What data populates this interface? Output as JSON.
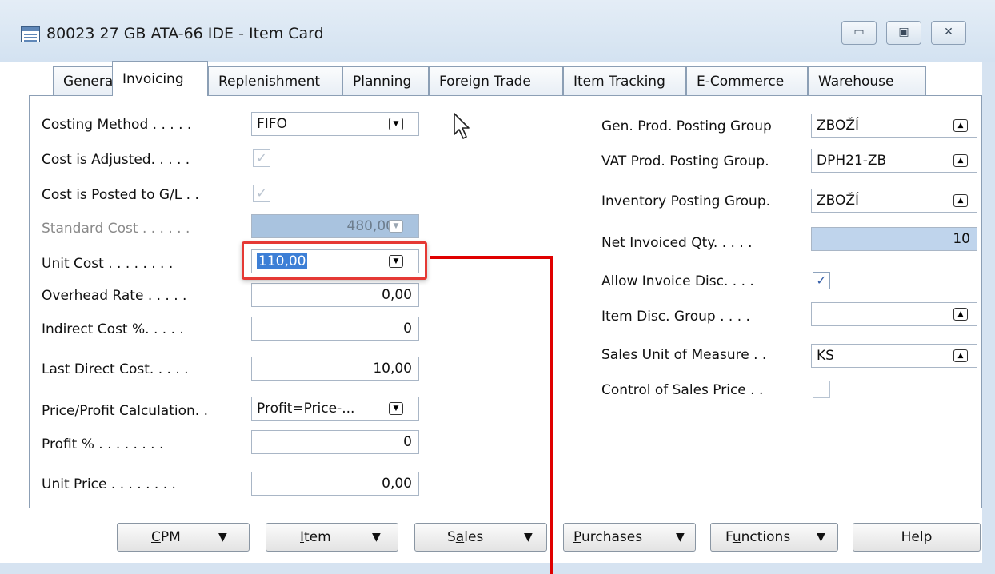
{
  "window": {
    "title": "80023 27 GB ATA-66 IDE - Item Card",
    "controls": {
      "minimize": "▭",
      "maximize": "▣",
      "close": "✕"
    }
  },
  "tabs": [
    "General",
    "Invoicing",
    "Replenishment",
    "Planning",
    "Foreign Trade",
    "Item Tracking",
    "E-Commerce",
    "Warehouse"
  ],
  "active_tab": "Invoicing",
  "left": {
    "costing_method": {
      "label": "Costing Method . . . . .",
      "value": "FIFO"
    },
    "cost_adjusted": {
      "label": "Cost is Adjusted. . . . .",
      "checked": true
    },
    "cost_posted": {
      "label": "Cost is Posted to G/L . .",
      "checked": true
    },
    "standard_cost": {
      "label": "Standard Cost . . . . . .",
      "value": "480,00"
    },
    "unit_cost": {
      "label": "Unit Cost . . . . . . . .",
      "value": "110,00"
    },
    "overhead_rate": {
      "label": "Overhead Rate . . . . .",
      "value": "0,00"
    },
    "indirect_cost": {
      "label": "Indirect Cost %. . . . .",
      "value": "0"
    },
    "last_direct_cost": {
      "label": "Last Direct Cost. . . . .",
      "value": "10,00"
    },
    "price_profit_calc": {
      "label": "Price/Profit Calculation. .",
      "value": "Profit=Price-..."
    },
    "profit_pct": {
      "label": "Profit % . . . . . . . .",
      "value": "0"
    },
    "unit_price": {
      "label": "Unit Price . . . . . . . .",
      "value": "0,00"
    }
  },
  "right": {
    "gen_prod_group": {
      "label": "Gen. Prod. Posting Group",
      "value": "ZBOŽÍ"
    },
    "vat_prod_group": {
      "label": "VAT Prod. Posting Group.",
      "value": "DPH21-ZB"
    },
    "inventory_group": {
      "label": "Inventory Posting Group.",
      "value": "ZBOŽÍ"
    },
    "net_invoiced_qty": {
      "label": "Net Invoiced Qty. . . . .",
      "value": "10"
    },
    "allow_invoice_disc": {
      "label": "Allow Invoice Disc. . . .",
      "checked": true
    },
    "item_disc_group": {
      "label": "Item Disc. Group . . . .",
      "value": ""
    },
    "sales_uom": {
      "label": "Sales Unit of Measure . .",
      "value": "KS"
    },
    "control_sales_price": {
      "label": "Control of Sales Price . .",
      "checked": false
    }
  },
  "buttons": {
    "cpm": {
      "pre": "",
      "u": "C",
      "post": "PM"
    },
    "item": {
      "pre": "",
      "u": "I",
      "post": "tem"
    },
    "sales": {
      "pre": "S",
      "u": "a",
      "post": "les"
    },
    "purchases": {
      "pre": "",
      "u": "P",
      "post": "urchases"
    },
    "functions": {
      "pre": "F",
      "u": "u",
      "post": "nctions"
    },
    "help": {
      "label": "Help"
    }
  },
  "icons": {
    "dropdown": "▼",
    "lookup": "▲",
    "drilldown": "▼",
    "checkmark": "✓",
    "caret": "▼"
  },
  "colors": {
    "highlight": "#e53935",
    "arrow": "#e00000",
    "selection": "#3d7fd6",
    "readonly_field": "#bfd4ec"
  }
}
